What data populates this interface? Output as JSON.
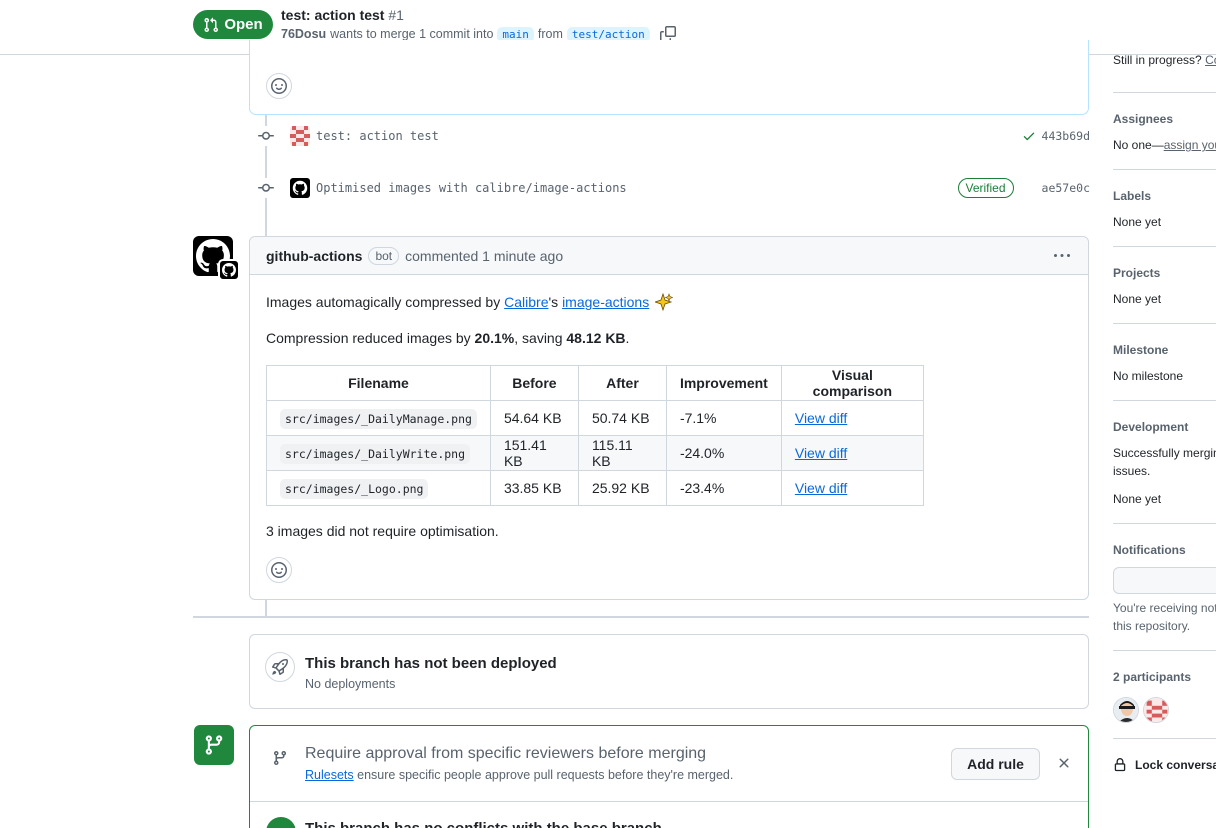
{
  "header": {
    "state": "Open",
    "title": "test: action test",
    "number": "#1",
    "author": "76Dosu",
    "merge_text": "wants to merge 1 commit into",
    "base_branch": "main",
    "from_text": "from",
    "head_branch": "test/action"
  },
  "commits": [
    {
      "message": "test: action test",
      "sha": "443b69d",
      "status": "check"
    },
    {
      "message": "Optimised images with calibre/image-actions",
      "sha": "ae57e0c",
      "badge": "Verified"
    }
  ],
  "comment": {
    "author": "github-actions",
    "bot_label": "bot",
    "meta": "commented 1 minute ago",
    "line1_prefix": "Images automagically compressed by",
    "link1": "Calibre",
    "line1_mid": "'s",
    "link2": "image-actions",
    "line2_prefix": "Compression reduced images by",
    "percent": "20.1%",
    "line2_mid": ", saving",
    "saving": "48.12 KB",
    "line2_end": ".",
    "table": {
      "headers": [
        "Filename",
        "Before",
        "After",
        "Improvement",
        "Visual comparison"
      ],
      "rows": [
        [
          "src/images/_DailyManage.png",
          "54.64 KB",
          "50.74 KB",
          "-7.1%",
          "View diff"
        ],
        [
          "src/images/_DailyWrite.png",
          "151.41 KB",
          "115.11 KB",
          "-24.0%",
          "View diff"
        ],
        [
          "src/images/_Logo.png",
          "33.85 KB",
          "25.92 KB",
          "-23.4%",
          "View diff"
        ]
      ]
    },
    "footer": "3 images did not require optimisation."
  },
  "deploy": {
    "title": "This branch has not been deployed",
    "sub": "No deployments"
  },
  "merge": {
    "title": "Require approval from specific reviewers before merging",
    "link": "Rulesets",
    "sub": "ensure specific people approve pull requests before they're merged.",
    "add_rule": "Add rule",
    "conflicts": "This branch has no conflicts with the base branch"
  },
  "sidebar": {
    "in_progress": "Still in progress?",
    "in_progress_link": "Co",
    "assignees_title": "Assignees",
    "assignees_val": "No one—",
    "assignees_link": "assign you",
    "labels_title": "Labels",
    "labels_val": "None yet",
    "projects_title": "Projects",
    "projects_val": "None yet",
    "milestone_title": "Milestone",
    "milestone_val": "No milestone",
    "development_title": "Development",
    "development_val1": "Successfully mergin",
    "development_val2": "issues.",
    "development_val3": "None yet",
    "notifications_title": "Notifications",
    "notifications_val1": "You're receiving not",
    "notifications_val2": "this repository.",
    "participants_title": "2 participants",
    "lock": "Lock conversat"
  },
  "colors": {
    "green": "#1f883d",
    "link": "#0969da",
    "border": "#d0d7de",
    "muted": "#59636e"
  }
}
